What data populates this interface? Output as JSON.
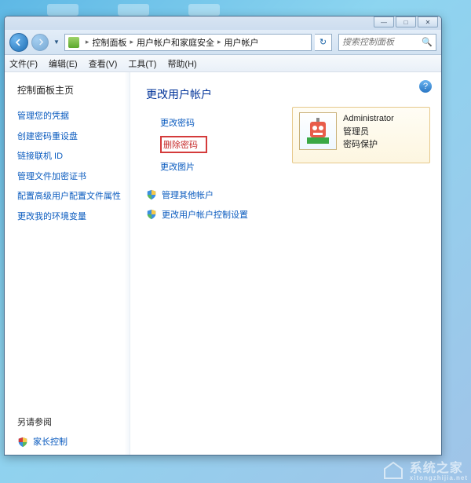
{
  "window_buttons": {
    "min": "—",
    "max": "□",
    "close": "✕"
  },
  "breadcrumb": {
    "root": "控制面板",
    "mid": "用户帐户和家庭安全",
    "leaf": "用户帐户"
  },
  "search": {
    "placeholder": "搜索控制面板"
  },
  "menu": {
    "file": "文件(F)",
    "edit": "编辑(E)",
    "view": "查看(V)",
    "tools": "工具(T)",
    "help": "帮助(H)"
  },
  "sidebar": {
    "home": "控制面板主页",
    "links": [
      "管理您的凭据",
      "创建密码重设盘",
      "链接联机 ID",
      "管理文件加密证书",
      "配置高级用户配置文件属性",
      "更改我的环境变量"
    ],
    "see_also": "另请参阅",
    "parental": "家长控制"
  },
  "main": {
    "heading": "更改用户帐户",
    "links": {
      "change_pw": "更改密码",
      "delete_pw": "删除密码",
      "change_pic": "更改图片",
      "manage_other": "管理其他帐户",
      "uac": "更改用户帐户控制设置"
    }
  },
  "account": {
    "name": "Administrator",
    "role": "管理员",
    "protected": "密码保护"
  },
  "watermark": {
    "big": "系统之家",
    "small": "xitongzhijia.net"
  }
}
